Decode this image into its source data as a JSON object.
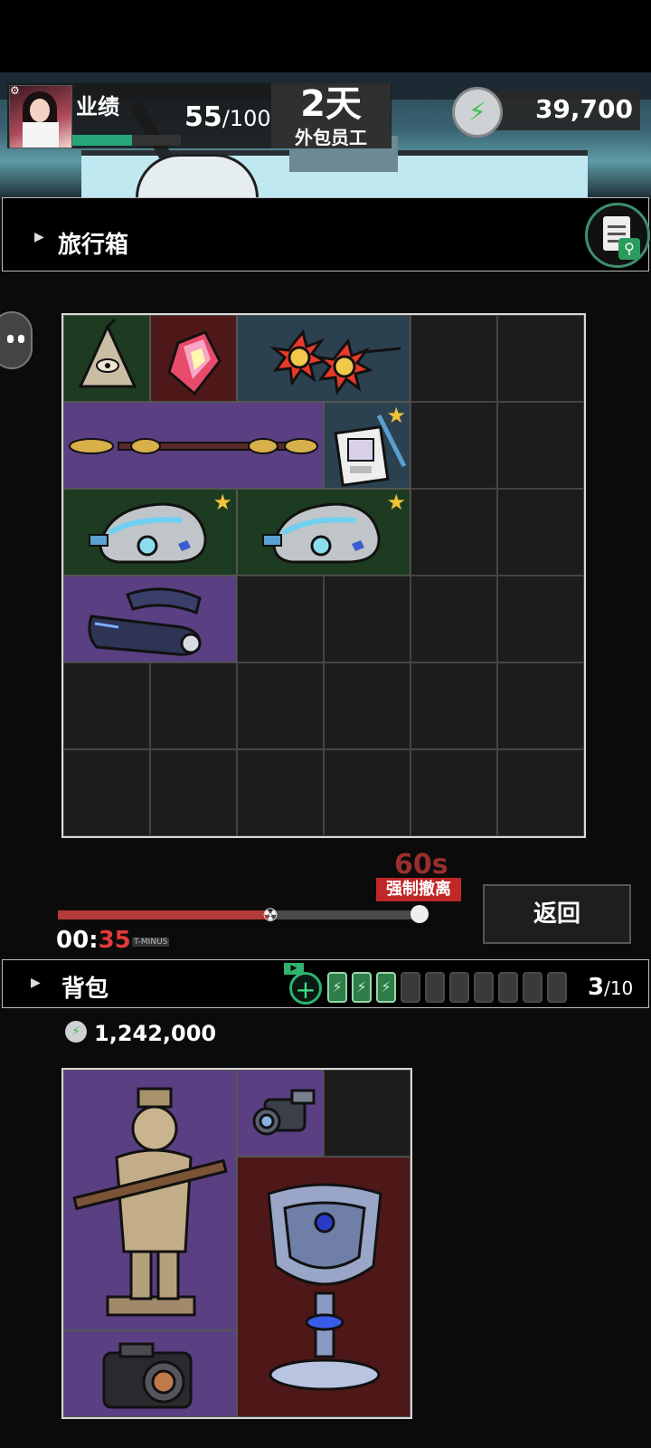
{
  "header": {
    "settings_icon": "gear-icon",
    "performance_label": "业绩",
    "performance_current": "55",
    "performance_max": "/100",
    "performance_fraction": 0.55,
    "days": "2天",
    "role": "外包员工",
    "currency_icon": "lightning-coin-icon",
    "currency": "39,700"
  },
  "suitcase": {
    "title": "旅行箱",
    "inspect_icon": "clipboard-search-icon",
    "items": [
      {
        "name": "pyramid-eye-item",
        "color": "#1d3b20"
      },
      {
        "name": "rainbow-crystal-item",
        "color": "#4e1818"
      },
      {
        "name": "sun-flowers-item",
        "color": "#2c4150"
      },
      {
        "name": "ornate-staff-item",
        "color": "#5a3f82"
      },
      {
        "name": "employee-badge-item",
        "color": "#2c4150",
        "starred": true
      },
      {
        "name": "visor-helmet-item-1",
        "color": "#1d3b20",
        "starred": true
      },
      {
        "name": "visor-helmet-item-2",
        "color": "#1d3b20",
        "starred": true
      },
      {
        "name": "vr-headset-item",
        "color": "#5a3f82"
      }
    ]
  },
  "evac": {
    "countdown": "60s",
    "label": "强制撤离",
    "progress_fraction": 0.58,
    "timer_min": "00:",
    "timer_sec": "35",
    "timer_tag": "T-MINUS",
    "return_label": "返回"
  },
  "backpack": {
    "title": "背包",
    "ad_tag": "▶",
    "add_icon": "plus-icon",
    "slots_filled": 3,
    "slots_total": 10,
    "count_current": "3",
    "count_max": "/10",
    "money": "1,242,000",
    "items": [
      {
        "name": "terracotta-soldier-item",
        "color": "#5a3f82"
      },
      {
        "name": "scope-item",
        "color": "#5a3f82"
      },
      {
        "name": "jeweled-chalice-item",
        "color": "#4e1818"
      },
      {
        "name": "camera-item",
        "color": "#5a3f82"
      }
    ]
  }
}
